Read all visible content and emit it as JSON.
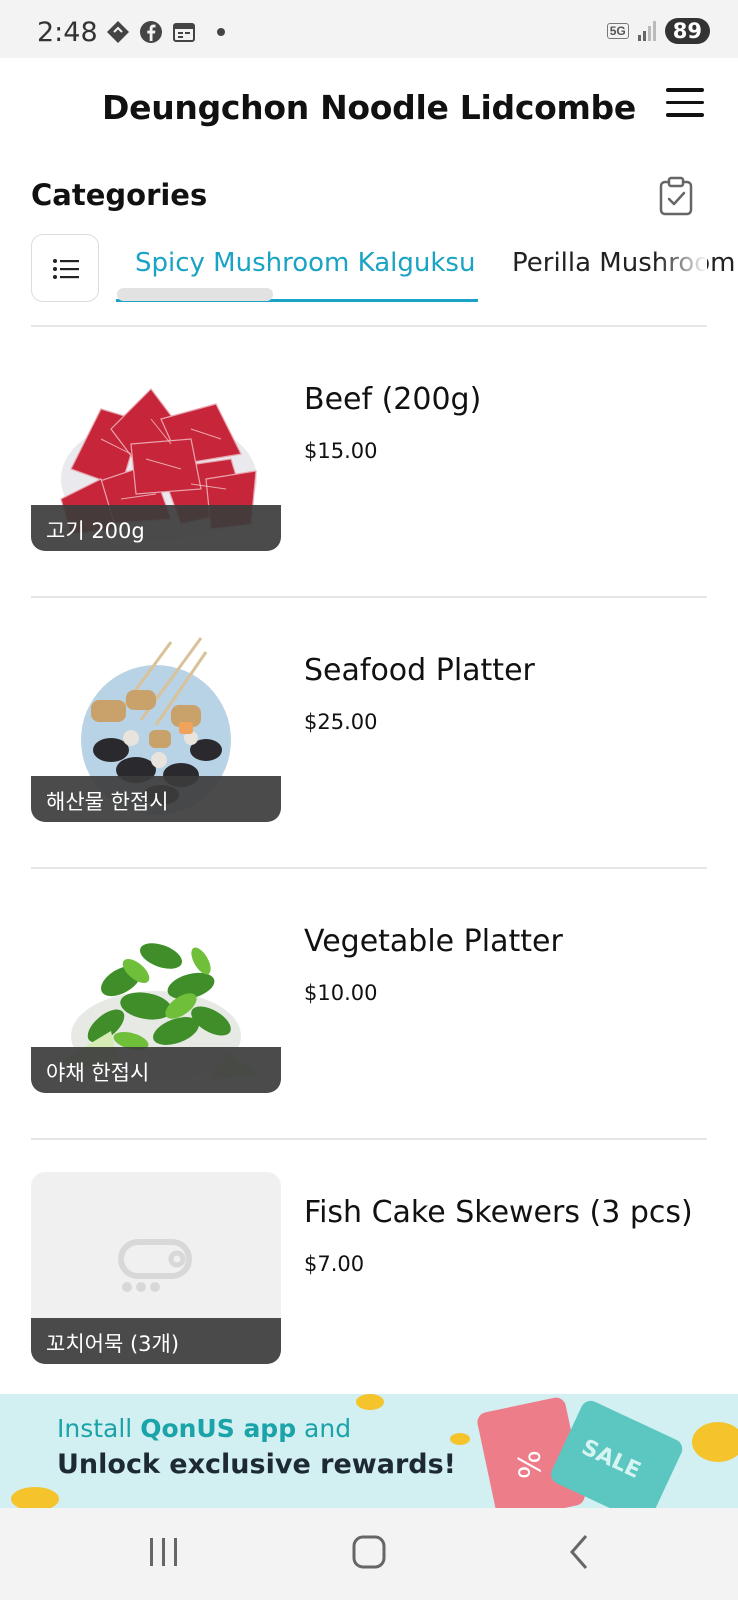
{
  "status_bar": {
    "time": "2:48",
    "network": "5G",
    "battery": "89"
  },
  "header": {
    "title": "Deungchon Noodle Lidcombe",
    "menu_icon": "hamburger-menu-icon"
  },
  "categories": {
    "title": "Categories",
    "clipboard_icon": "clipboard-check-icon",
    "list_icon": "list-icon",
    "tabs": [
      {
        "label": "Spicy Mushroom Kalguksu",
        "active": true
      },
      {
        "label": "Perilla Mushroom",
        "active": false
      }
    ],
    "accent_color": "#1aa3c4"
  },
  "items": [
    {
      "name": "Beef (200g)",
      "price": "$15.00",
      "thumb_label": "고기 200g",
      "image": "beef-slices"
    },
    {
      "name": "Seafood Platter",
      "price": "$25.00",
      "thumb_label": "해산물 한접시",
      "image": "seafood-platter"
    },
    {
      "name": "Vegetable Platter",
      "price": "$10.00",
      "thumb_label": "야채 한접시",
      "image": "vegetable-platter"
    },
    {
      "name": "Fish Cake Skewers (3 pcs)",
      "price": "$7.00",
      "thumb_label": "꼬치어묵 (3개)",
      "image": "placeholder"
    }
  ],
  "banner": {
    "line1_prefix": "Install ",
    "line1_brand": "QonUS app",
    "line1_suffix": " and",
    "line2": "Unlock exclusive rewards!",
    "coupon_text": "SALE"
  },
  "navbar": {
    "recent_icon": "recent-apps-icon",
    "home_icon": "home-icon",
    "back_icon": "back-icon"
  }
}
